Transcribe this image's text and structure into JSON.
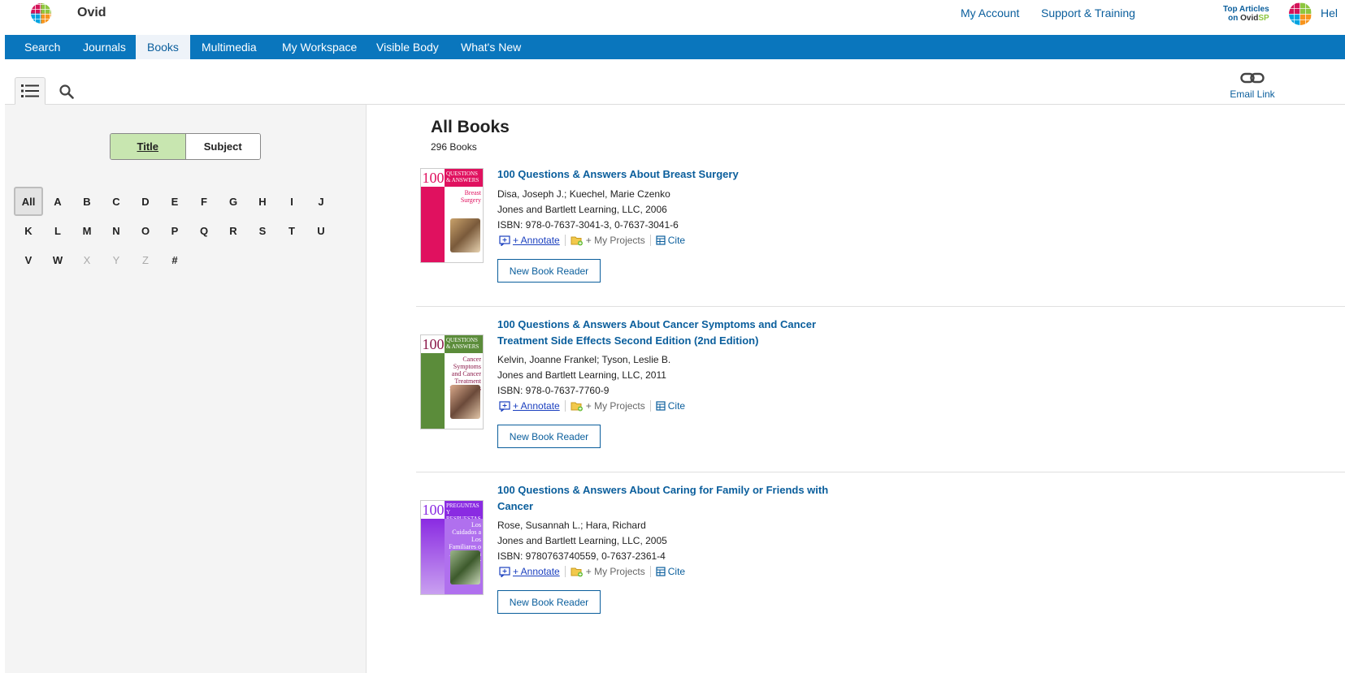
{
  "header": {
    "brand": "Ovid",
    "links": [
      "My Account",
      "Support & Training"
    ],
    "top_articles": {
      "line1": "Top Articles",
      "on": "on ",
      "ovid": "Ovid",
      "sp": "SP"
    },
    "help_partial": "Hel"
  },
  "nav": {
    "items": [
      "Search",
      "Journals",
      "Books",
      "Multimedia",
      "My Workspace",
      "Visible Body",
      "What's New"
    ],
    "active": "Books"
  },
  "toolbar": {
    "email_link": "Email Link"
  },
  "browse": {
    "toggle": {
      "title": "Title",
      "subject": "Subject"
    },
    "letters": [
      "All",
      "A",
      "B",
      "C",
      "D",
      "E",
      "F",
      "G",
      "H",
      "I",
      "J",
      "K",
      "L",
      "M",
      "N",
      "O",
      "P",
      "Q",
      "R",
      "S",
      "T",
      "U",
      "V",
      "W",
      "X",
      "Y",
      "Z",
      "#"
    ],
    "disabled_letters": [
      "X",
      "Y",
      "Z"
    ],
    "active_letter": "All"
  },
  "main": {
    "title": "All Books",
    "count": "296 Books",
    "actions": {
      "annotate": "+ Annotate",
      "projects": "+ My Projects",
      "cite": "Cite"
    },
    "reader_button": "New Book Reader",
    "books": [
      {
        "title": "100 Questions & Answers About Breast Surgery",
        "authors": "Disa, Joseph J.; Kuechel, Marie Czenko",
        "publisher": "Jones and Bartlett Learning, LLC, 2006",
        "isbn": "ISBN: 978-0-7637-3041-3, 0-7637-3041-6",
        "cover": {
          "num": "100",
          "band": "QUESTIONS & ANSWERS",
          "sub": "Breast Surgery",
          "color": "#e0115f"
        }
      },
      {
        "title": "100 Questions & Answers About Cancer Symptoms and Cancer Treatment Side Effects Second Edition (2nd Edition)",
        "authors": "Kelvin, Joanne Frankel; Tyson, Leslie B.",
        "publisher": "Jones and Bartlett Learning, LLC, 2011",
        "isbn": "ISBN: 978-0-7637-7760-9",
        "cover": {
          "num": "100",
          "band": "QUESTIONS & ANSWERS",
          "sub": "Cancer Symptoms and Cancer Treatment Side Effects",
          "color": "#5b8c3a"
        }
      },
      {
        "title": "100 Questions & Answers About Caring for Family or Friends with Cancer",
        "authors": "Rose, Susannah L.; Hara, Richard",
        "publisher": "Jones and Bartlett Learning, LLC, 2005",
        "isbn": "ISBN: 9780763740559, 0-7637-2361-4",
        "cover": {
          "num": "100",
          "band": "PREGUNTAS Y RESPUESTAS",
          "sub": "Los Cuidados a Los Familiares o Amigos con Cancer",
          "color": "#8a2be2"
        }
      }
    ]
  }
}
